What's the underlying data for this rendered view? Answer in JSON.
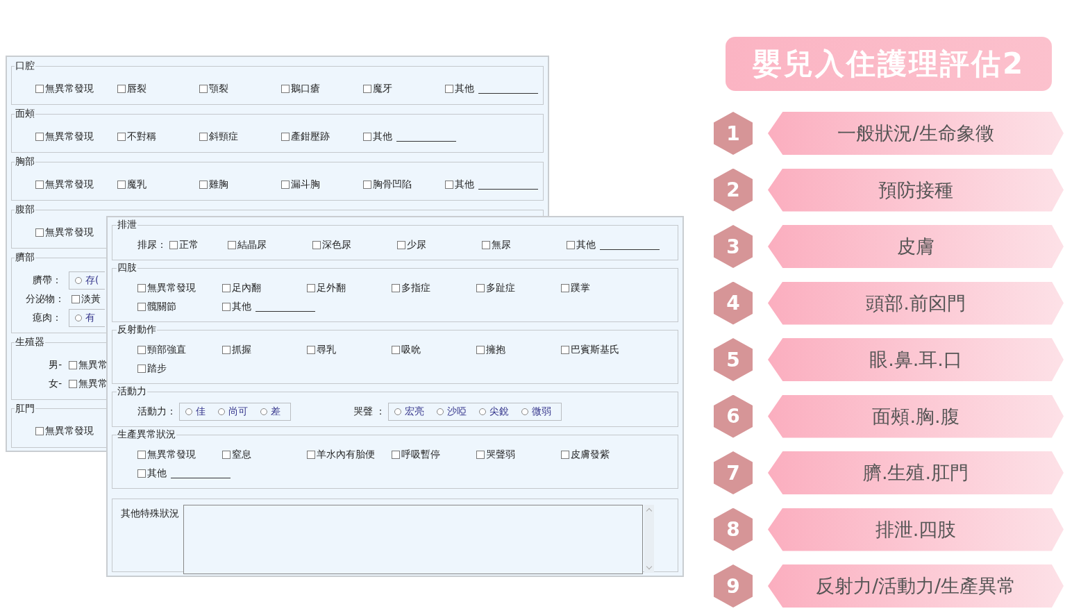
{
  "left_form": {
    "sections": [
      {
        "kind": "group",
        "title": "口腔",
        "rows": [
          {
            "cells": [
              {
                "kind": "check",
                "label": "無異常發現",
                "checked": false
              },
              {
                "kind": "check",
                "label": "唇裂",
                "checked": false
              },
              {
                "kind": "check",
                "label": "顎裂",
                "checked": false
              },
              {
                "kind": "check",
                "label": "鵝口瘡",
                "checked": false
              },
              {
                "kind": "check",
                "label": "魔牙",
                "checked": false
              },
              {
                "kind": "other",
                "label": "其他",
                "checked": false
              }
            ]
          }
        ]
      },
      {
        "kind": "group",
        "title": "面頰",
        "rows": [
          {
            "cells": [
              {
                "kind": "check",
                "label": "無異常發現",
                "checked": false
              },
              {
                "kind": "check",
                "label": "不對稱",
                "checked": false
              },
              {
                "kind": "check",
                "label": "斜頸症",
                "checked": false
              },
              {
                "kind": "check",
                "label": "產鉗壓跡",
                "checked": false
              },
              {
                "kind": "other",
                "label": "其他",
                "checked": false
              }
            ]
          }
        ]
      },
      {
        "kind": "group",
        "title": "胸部",
        "rows": [
          {
            "cells": [
              {
                "kind": "check",
                "label": "無異常發現",
                "checked": false
              },
              {
                "kind": "check",
                "label": "魔乳",
                "checked": false
              },
              {
                "kind": "check",
                "label": "雞胸",
                "checked": false
              },
              {
                "kind": "check",
                "label": "漏斗胸",
                "checked": false
              },
              {
                "kind": "check",
                "label": "胸骨凹陷",
                "checked": false
              },
              {
                "kind": "other",
                "label": "其他",
                "checked": false
              }
            ]
          }
        ]
      },
      {
        "kind": "group",
        "title": "腹部",
        "rows": [
          {
            "cells": [
              {
                "kind": "check",
                "label": "無異常發現",
                "checked": false
              }
            ]
          }
        ]
      },
      {
        "kind": "group",
        "title": "臍部",
        "rows": [
          {
            "cells": [
              {
                "kind": "text",
                "text": "臍帶："
              },
              {
                "kind": "radios",
                "options": [
                  {
                    "label": "存(",
                    "selected": false
                  }
                ]
              }
            ]
          },
          {
            "cells": [
              {
                "kind": "text",
                "text": "分泌物："
              },
              {
                "kind": "check",
                "label": "淡黃",
                "checked": false
              }
            ]
          },
          {
            "cells": [
              {
                "kind": "text",
                "text": "瘜肉："
              },
              {
                "kind": "radios",
                "options": [
                  {
                    "label": "有",
                    "selected": false
                  }
                ]
              }
            ]
          }
        ]
      },
      {
        "kind": "group",
        "title": "生殖器",
        "rows": [
          {
            "cells": [
              {
                "kind": "text",
                "text": "男-"
              },
              {
                "kind": "check",
                "label": "無異常",
                "checked": false
              }
            ]
          },
          {
            "cells": [
              {
                "kind": "text",
                "text": "女-"
              },
              {
                "kind": "check",
                "label": "無異常",
                "checked": false
              }
            ]
          }
        ]
      },
      {
        "kind": "group",
        "title": "肛門",
        "rows": [
          {
            "cells": [
              {
                "kind": "check",
                "label": "無異常發現",
                "checked": false
              }
            ]
          }
        ]
      }
    ]
  },
  "right_form": {
    "sections": [
      {
        "kind": "group",
        "title": "排泄",
        "rows": [
          {
            "cells": [
              {
                "kind": "text",
                "text": "排尿："
              },
              {
                "kind": "check",
                "label": "正常",
                "checked": false
              },
              {
                "kind": "check",
                "label": "結晶尿",
                "checked": false
              },
              {
                "kind": "check",
                "label": "深色尿",
                "checked": false
              },
              {
                "kind": "check",
                "label": "少尿",
                "checked": false
              },
              {
                "kind": "check",
                "label": "無尿",
                "checked": false
              },
              {
                "kind": "other",
                "label": "其他",
                "checked": false
              }
            ]
          }
        ]
      },
      {
        "kind": "group",
        "title": "四肢",
        "rows": [
          {
            "cells": [
              {
                "kind": "check",
                "label": "無異常發現",
                "checked": false
              },
              {
                "kind": "check",
                "label": "足內翻",
                "checked": false
              },
              {
                "kind": "check",
                "label": "足外翻",
                "checked": false
              },
              {
                "kind": "check",
                "label": "多指症",
                "checked": false
              },
              {
                "kind": "check",
                "label": "多趾症",
                "checked": false
              },
              {
                "kind": "check",
                "label": "蹼掌",
                "checked": false
              }
            ]
          },
          {
            "cells": [
              {
                "kind": "check",
                "label": "髖關節",
                "checked": false
              },
              {
                "kind": "other",
                "label": "其他",
                "checked": false
              }
            ]
          }
        ]
      },
      {
        "kind": "group",
        "title": "反射動作",
        "rows": [
          {
            "cells": [
              {
                "kind": "check",
                "label": "頸部強直",
                "checked": false
              },
              {
                "kind": "check",
                "label": "抓握",
                "checked": false
              },
              {
                "kind": "check",
                "label": "尋乳",
                "checked": false
              },
              {
                "kind": "check",
                "label": "吸吮",
                "checked": false
              },
              {
                "kind": "check",
                "label": "擁抱",
                "checked": false
              },
              {
                "kind": "check",
                "label": "巴賓斯基氏",
                "checked": false
              }
            ]
          },
          {
            "cells": [
              {
                "kind": "check",
                "label": "踏步",
                "checked": false
              }
            ]
          }
        ]
      },
      {
        "kind": "group",
        "title": "活動力",
        "rows": [
          {
            "cells": [
              {
                "kind": "text",
                "text": "活動力："
              },
              {
                "kind": "radios",
                "options": [
                  {
                    "label": "佳",
                    "selected": false
                  },
                  {
                    "label": "尚可",
                    "selected": false
                  },
                  {
                    "label": "差",
                    "selected": false
                  }
                ]
              },
              {
                "kind": "text",
                "text": "哭聲 ："
              },
              {
                "kind": "radios",
                "options": [
                  {
                    "label": "宏亮",
                    "selected": false
                  },
                  {
                    "label": "沙啞",
                    "selected": false
                  },
                  {
                    "label": "尖銳",
                    "selected": false
                  },
                  {
                    "label": "微弱",
                    "selected": false
                  }
                ]
              }
            ]
          }
        ]
      },
      {
        "kind": "group",
        "title": "生產異常狀況",
        "rows": [
          {
            "cells": [
              {
                "kind": "check",
                "label": "無異常發現",
                "checked": false
              },
              {
                "kind": "check",
                "label": "窒息",
                "checked": false
              },
              {
                "kind": "check",
                "label": "羊水內有胎便",
                "checked": false
              },
              {
                "kind": "check",
                "label": "呼吸暫停",
                "checked": false
              },
              {
                "kind": "check",
                "label": "哭聲弱",
                "checked": false
              },
              {
                "kind": "check",
                "label": "皮膚發紫",
                "checked": false
              }
            ]
          },
          {
            "cells": [
              {
                "kind": "other",
                "label": "其他",
                "checked": false
              }
            ]
          }
        ]
      },
      {
        "kind": "notes",
        "label": "其他特殊狀況"
      }
    ]
  },
  "slide": {
    "title": "嬰兒入住護理評估2",
    "items": [
      {
        "number": "1",
        "label": "一般狀況/生命象徵"
      },
      {
        "number": "2",
        "label": "預防接種"
      },
      {
        "number": "3",
        "label": "皮膚"
      },
      {
        "number": "4",
        "label": "頭部.前囟門"
      },
      {
        "number": "5",
        "label": "眼.鼻.耳.口"
      },
      {
        "number": "6",
        "label": "面頰.胸.腹"
      },
      {
        "number": "7",
        "label": "臍.生殖.肛門"
      },
      {
        "number": "8",
        "label": "排泄.四肢"
      },
      {
        "number": "9",
        "label": "反射力/活動力/生產異常"
      }
    ]
  }
}
